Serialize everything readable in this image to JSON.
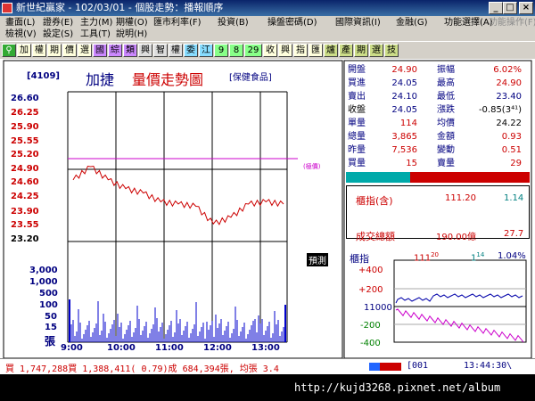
{
  "window": {
    "title": "新世紀贏家 - 102/03/01 - 個股走勢：播報順序"
  },
  "menus": [
    {
      "label": "畫面(L)"
    },
    {
      "label": "證券(E)"
    },
    {
      "label": "主力(M)"
    },
    {
      "label": "期權(O)"
    },
    {
      "label": "匯市利率(F)"
    },
    {
      "label": "投資(B)"
    },
    {
      "label": "操盤密碼(D)"
    },
    {
      "label": "國際資訊(I)"
    },
    {
      "label": "金融(G)"
    },
    {
      "label": "功能選擇(A)"
    },
    {
      "label": "功能操作(F)"
    },
    {
      "label": "檢視(V)"
    },
    {
      "label": "設定(S)"
    },
    {
      "label": "工具(T)"
    },
    {
      "label": "說明(H)"
    }
  ],
  "toolbar": [
    "加",
    "權",
    "期",
    "價",
    "選",
    "國",
    "綜",
    "類",
    "興",
    "智",
    "權",
    "委",
    "江",
    "9",
    "8",
    "29",
    "收",
    "興",
    "指",
    "匯",
    "爐",
    "產",
    "期",
    "選",
    "技"
  ],
  "stock": {
    "code": "4109",
    "name": "加捷",
    "chart_title": "量價走勢圖",
    "industry": "[保健食品]"
  },
  "price_labels": [
    "26.60",
    "26.25",
    "25.90",
    "25.55",
    "25.20",
    "24.90",
    "24.60",
    "24.25",
    "23.90",
    "23.55",
    "23.20"
  ],
  "volume_labels": [
    "3,000",
    "1,000",
    "500",
    "100",
    "50",
    "15",
    "張"
  ],
  "time_labels": [
    "9:00",
    "10:00",
    "11:00",
    "12:00",
    "13:00"
  ],
  "limit_tag": "(極價)",
  "forecast_tag": "預測",
  "quote": {
    "open_label": "開盤",
    "open": "24.90",
    "amp_label": "振幅",
    "amp": "6.02%",
    "bid_label": "買進",
    "bid": "24.05",
    "high_label": "最高",
    "high": "24.90",
    "ask_label": "賣出",
    "ask": "24.10",
    "low_label": "最低",
    "low": "23.40",
    "close_label": "收盤",
    "close": "24.05",
    "chg_label": "漲跌",
    "chg": "-0.85(3⁴¹)",
    "unit_vol_label": "單量",
    "unit_vol": "114",
    "avg_label": "均價",
    "avg": "24.22",
    "tot_vol_label": "總量",
    "tot_vol": "3,865",
    "amount_label": "金額",
    "amount": "0.93",
    "prev_vol_label": "昨量",
    "prev_vol": "7,536",
    "vol_chg_label": "變動",
    "vol_chg": "0.51",
    "buy_vol_label": "買量",
    "buy_vol": "15",
    "sell_vol_label": "賣量",
    "sell_vol": "29"
  },
  "index_box": {
    "label": "櫃指(含)",
    "value": "111.20",
    "change": "1.14",
    "turnover_label": "成交總額",
    "turnover": "190.00億",
    "turnover_chg": "27.7"
  },
  "otc_chart": {
    "label": "櫃指",
    "value_main": "111",
    "value_sub": "20",
    "chg_main": "1",
    "chg_sub": "14",
    "pct": "1.04%",
    "ticks": [
      "+400",
      "+200",
      "11000",
      "-200",
      "-400"
    ]
  },
  "status": {
    "text": "買 1,747,288買 1,388,411( 0.79)成 684,394張, 均張 3.4",
    "page": "[001",
    "clock": "13:44:30\\"
  },
  "footer_url": "http://kujd3268.pixnet.net/album",
  "chart_data": {
    "type": "line",
    "title": "量價走勢圖",
    "x": [
      "9:00",
      "10:00",
      "11:00",
      "12:00",
      "13:00"
    ],
    "series": [
      {
        "values": [
          24.6,
          24.9,
          24.6,
          24.4,
          24.3,
          24.1,
          24.05,
          24.0,
          23.6,
          23.75,
          24.05,
          24.1,
          24.05
        ]
      }
    ],
    "ylim": [
      23.2,
      26.6
    ]
  }
}
